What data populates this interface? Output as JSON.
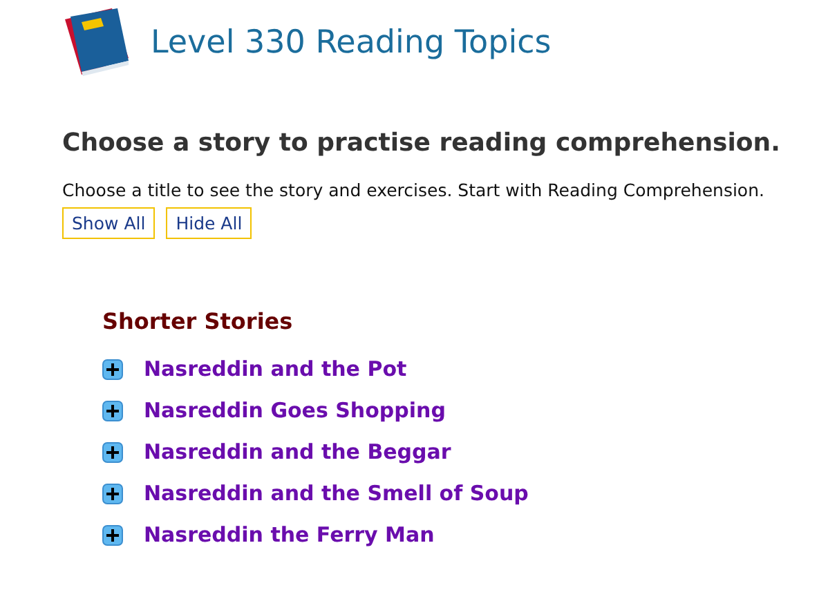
{
  "header": {
    "title": "Level 330 Reading Topics"
  },
  "intro": {
    "heading": "Choose a story to practise reading comprehension.",
    "text": "Choose a title to see the story and exercises. Start with Reading Comprehension."
  },
  "buttons": [
    "Show All",
    "Hide All"
  ],
  "section": {
    "title": "Shorter Stories",
    "items": [
      {
        "title": "Nasreddin and the Pot",
        "expanded": false
      },
      {
        "title": "Nasreddin Goes Shopping",
        "expanded": false
      },
      {
        "title": "Nasreddin and the Beggar",
        "expanded": false
      },
      {
        "title": "Nasreddin and the Smell of Soup",
        "expanded": false
      },
      {
        "title": "Nasreddin the Ferry Man",
        "expanded": false
      }
    ]
  }
}
